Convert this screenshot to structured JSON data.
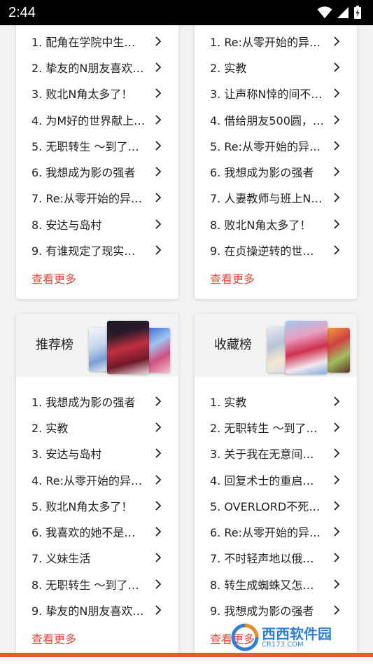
{
  "status_bar": {
    "time": "2:44"
  },
  "top_left": {
    "items": [
      "1. 配角在学院中生…",
      "2. 挚友的N朋友喜欢…",
      "3. 败北N角太多了！",
      "4. 为M好的世界献上…",
      "5. 无职转生 ～到了…",
      "6. 我想成为影の强者",
      "7. Re:从零开始的异…",
      "8. 安达与岛村",
      "9. 有谁规定了现实…"
    ],
    "more": "查看更多"
  },
  "top_right": {
    "items": [
      "1. Re:从零开始的异…",
      "2. 实教",
      "3. 让声称N悻的间不…",
      "4. 借给朋友500圆，…",
      "5. Re:从零开始的异…",
      "6. 我想成为影の强者",
      "7. 人妻教师与班上N…",
      "8. 败北N角太多了！",
      "9. 在贞操逆转的世…"
    ],
    "more": "查看更多"
  },
  "recommend": {
    "title": "推荐榜",
    "items": [
      "1. 我想成为影の强者",
      "2. 实教",
      "3. 安达与岛村",
      "4. Re:从零开始的异…",
      "5. 败北N角太多了！",
      "6. 我喜欢的她不是…",
      "7. 义妹生活",
      "8. 无职转生 ～到了…",
      "9. 挚友的N朋友喜欢…"
    ],
    "more": "查看更多"
  },
  "favorites": {
    "title": "收藏榜",
    "items": [
      "1. 实教",
      "2. 无职转生 ～到了…",
      "3. 关于我在无意间…",
      "4. 回复术士的重启…",
      "5. OVERLORD不死…",
      "6. Re:从零开始的异…",
      "7. 不时轻声地以俄…",
      "8. 转生成蜘蛛又怎…",
      "9. 我想成为影の强者"
    ],
    "more": "查看更多"
  },
  "watermark": {
    "text": "西西软件园",
    "sub": "CR173.COM"
  },
  "colors": {
    "accent": "#e8483a",
    "header_bg": "#f3f3f3",
    "bottom_strip": "#e85a2a"
  }
}
